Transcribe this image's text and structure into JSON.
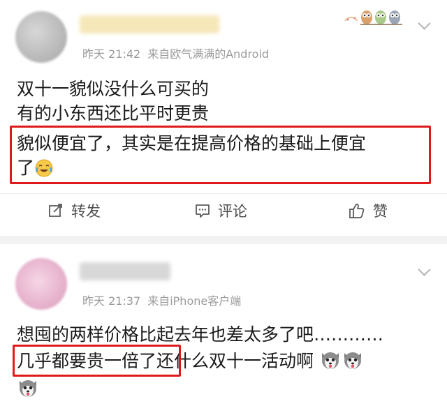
{
  "post1": {
    "time": "昨天 21:42",
    "source": "来自欧气满满的Android",
    "lines": [
      "双十一貌似没什么可买的",
      "有的小东西还比平时更贵",
      "貌似便宜了，其实是在提高价格的基础上便宜",
      "了"
    ],
    "actions": {
      "repost": "转发",
      "comment": "评论",
      "like": "赞"
    }
  },
  "post2": {
    "time": "昨天 21:37",
    "source": "来自iPhone客户端",
    "lines": [
      "想囤的两样价格比起去年也差太多了吧…………",
      "几乎都要贵一倍了还什么双十一活动啊"
    ]
  },
  "icons": {
    "laugh_cry": "laugh-cry-emoji",
    "husky": "husky-emoji",
    "owls": "owl-badge",
    "chevron": "chevron-down",
    "repost": "edit-square",
    "comment": "comment-bubble",
    "like": "thumbs-up"
  },
  "colors": {
    "highlight_box": "#e01a1a",
    "meta_text": "#9a9a9a",
    "body_text": "#1a1a1a"
  }
}
